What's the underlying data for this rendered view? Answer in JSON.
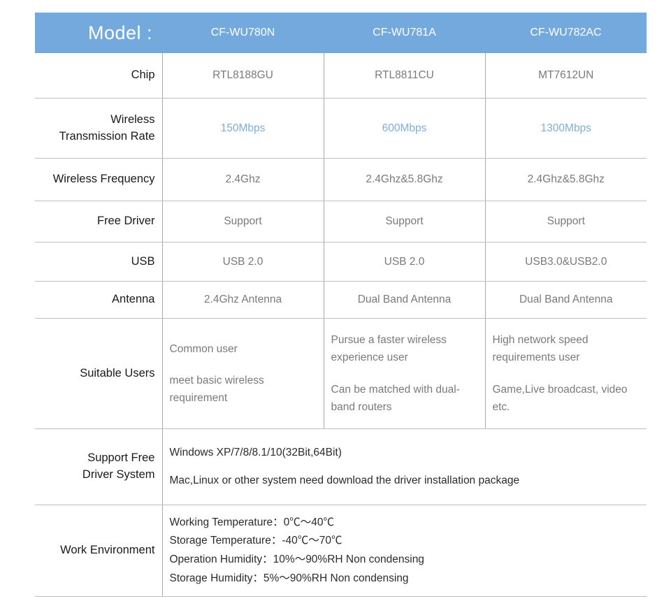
{
  "header": {
    "model_label": "Model :",
    "products": [
      "CF-WU780N",
      "CF-WU781A",
      "CF-WU782AC"
    ],
    "accent_color": "#74a9de"
  },
  "colors": {
    "header_bg": "#74a9de",
    "header_text": "#ffffff",
    "label_text": "#1a1a1a",
    "value_text": "#7a7a7a",
    "rate_text": "#7faedb",
    "border": "#bfbfbf"
  },
  "rows": {
    "chip": {
      "label": "Chip",
      "values": [
        "RTL8188GU",
        "RTL8811CU",
        "MT7612UN"
      ]
    },
    "rate": {
      "label_line1": "Wireless",
      "label_line2": "Transmission Rate",
      "values": [
        "150Mbps",
        "600Mbps",
        "1300Mbps"
      ]
    },
    "frequency": {
      "label": "Wireless Frequency",
      "values": [
        "2.4Ghz",
        "2.4Ghz&5.8Ghz",
        "2.4Ghz&5.8Ghz"
      ]
    },
    "free_driver": {
      "label": "Free Driver",
      "values": [
        "Support",
        "Support",
        "Support"
      ]
    },
    "usb": {
      "label": "USB",
      "values": [
        "USB 2.0",
        "USB 2.0",
        "USB3.0&USB2.0"
      ]
    },
    "antenna": {
      "label": "Antenna",
      "values": [
        "2.4Ghz Antenna",
        "Dual Band Antenna",
        "Dual Band Antenna"
      ]
    },
    "suitable_users": {
      "label": "Suitable Users",
      "col1": [
        "Common user",
        "meet basic wireless requirement"
      ],
      "col2": [
        "Pursue a faster wireless experience user",
        "Can be matched with dual-band routers"
      ],
      "col3": [
        "High network speed requirements user",
        "Game,Live broadcast, video etc."
      ]
    },
    "support_free_driver_system": {
      "label_line1": "Support Free",
      "label_line2": "Driver System",
      "lines": [
        "Windows XP/7/8/8.1/10(32Bit,64Bit)",
        "Mac,Linux or other system need download the driver installation package"
      ]
    },
    "work_environment": {
      "label": "Work Environment",
      "lines": [
        "Working Temperature：0℃～40℃",
        "Storage Temperature：-40℃～70℃",
        "Operation Humidity：10%～90%RH Non condensing",
        "Storage Humidity：5%～90%RH Non condensing"
      ]
    }
  }
}
